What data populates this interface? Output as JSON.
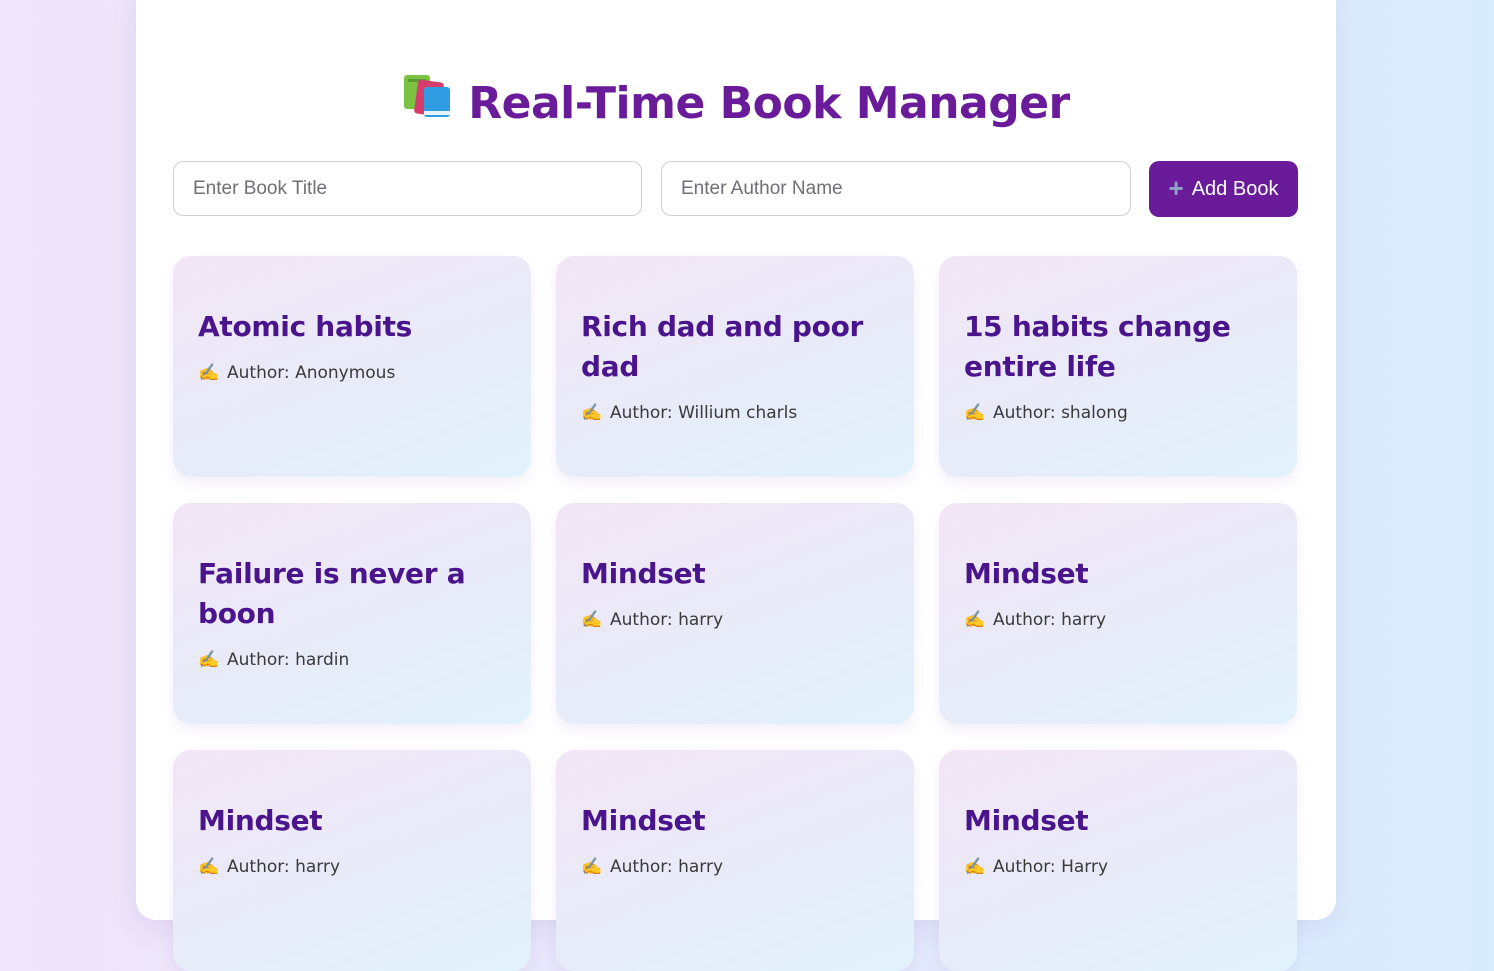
{
  "header": {
    "title": "Real-Time Book Manager",
    "icon": "books-icon"
  },
  "form": {
    "title_placeholder": "Enter Book Title",
    "author_placeholder": "Enter Author Name",
    "add_button_label": "Add Book",
    "add_button_icon": "plus-icon"
  },
  "author_prefix": "Author:",
  "books": [
    {
      "title": "Atomic habits",
      "author": "Author: Anonymous"
    },
    {
      "title": "Rich dad and poor dad",
      "author": "Author: Willium charls"
    },
    {
      "title": "15 habits change entire life",
      "author": "Author: shalong"
    },
    {
      "title": "Failure is never a boon",
      "author": "Author: hardin"
    },
    {
      "title": "Mindset",
      "author": "Author: harry"
    },
    {
      "title": "Mindset",
      "author": "Author: harry"
    },
    {
      "title": "Mindset",
      "author": "Author: harry"
    },
    {
      "title": "Mindset",
      "author": "Author: harry"
    },
    {
      "title": "Mindset",
      "author": "Author: Harry"
    }
  ],
  "colors": {
    "accent": "#6a1b9a",
    "card_title": "#4a148c"
  }
}
